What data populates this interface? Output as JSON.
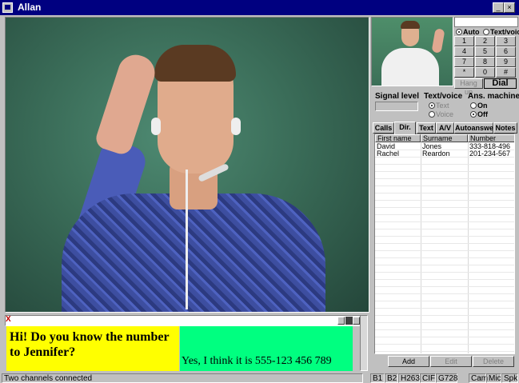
{
  "window": {
    "title": "Allan",
    "controls": [
      "_",
      "□",
      "×"
    ]
  },
  "chat": {
    "close_label": "X",
    "local_text": "Hi! Do you know the number to Jennifer?",
    "remote_text": "Yes, I think it is 555-123 456 789",
    "local_color": "#ffff00",
    "remote_color": "#00ff80"
  },
  "status": {
    "left": "Two channels connected",
    "cells": [
      "B1",
      "B2",
      "H263",
      "CIF",
      "G728",
      "Cam",
      "Mic",
      "Spk"
    ]
  },
  "dialer": {
    "number_value": "",
    "mode_auto": "Auto",
    "mode_textvoice": "Text/voice",
    "keys": [
      "1",
      "2",
      "3",
      "4",
      "5",
      "6",
      "7",
      "8",
      "9",
      "*",
      "0",
      "#"
    ],
    "hangup_label": "Hang up",
    "dial_label": "Dial"
  },
  "settings": {
    "signal_level_label": "Signal level",
    "textvoice_label": "Text/voice",
    "text_option": "Text",
    "voice_option": "Voice",
    "ans_machine_label": "Ans. machine",
    "on_option": "On",
    "off_option": "Off"
  },
  "tabs": [
    "Calls",
    "Dir.",
    "Text",
    "A/V",
    "Autoanswer",
    "Notes"
  ],
  "directory": {
    "columns": [
      "First name",
      "Surname",
      "Number"
    ],
    "rows": [
      [
        "David",
        "Jones",
        "333-818-496"
      ],
      [
        "Rachel",
        "Reardon",
        "201-234-567"
      ]
    ],
    "add_label": "Add",
    "edit_label": "Edit",
    "delete_label": "Delete"
  }
}
